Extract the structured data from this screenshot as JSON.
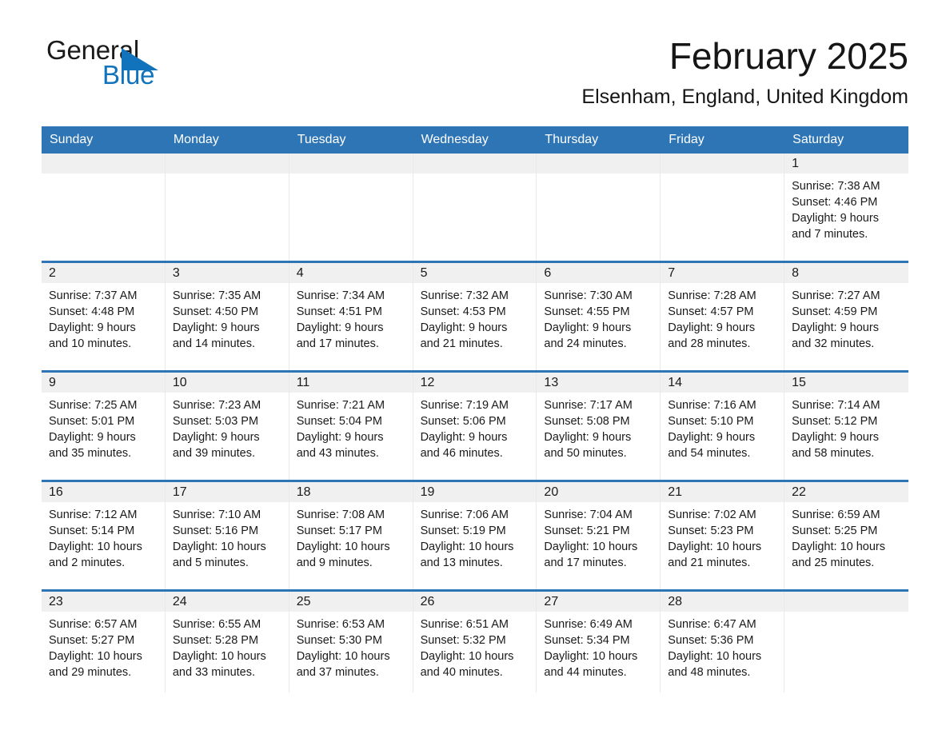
{
  "brand": {
    "name_part1": "General",
    "name_part2": "Blue",
    "triangle_color": "#1173bb",
    "text_color": "#1a1a1a"
  },
  "header": {
    "title": "February 2025",
    "subtitle": "Elsenham, England, United Kingdom"
  },
  "theme": {
    "header_blue": "#2e75b6",
    "day_band_gray": "#f0f0f0",
    "cell_border": "#e9e9e9"
  },
  "weekdays": [
    "Sunday",
    "Monday",
    "Tuesday",
    "Wednesday",
    "Thursday",
    "Friday",
    "Saturday"
  ],
  "weeks": [
    [
      {
        "day": "",
        "sunrise": "",
        "sunset": "",
        "daylight_line1": "",
        "daylight_line2": "",
        "empty": true
      },
      {
        "day": "",
        "sunrise": "",
        "sunset": "",
        "daylight_line1": "",
        "daylight_line2": "",
        "empty": true
      },
      {
        "day": "",
        "sunrise": "",
        "sunset": "",
        "daylight_line1": "",
        "daylight_line2": "",
        "empty": true
      },
      {
        "day": "",
        "sunrise": "",
        "sunset": "",
        "daylight_line1": "",
        "daylight_line2": "",
        "empty": true
      },
      {
        "day": "",
        "sunrise": "",
        "sunset": "",
        "daylight_line1": "",
        "daylight_line2": "",
        "empty": true
      },
      {
        "day": "",
        "sunrise": "",
        "sunset": "",
        "daylight_line1": "",
        "daylight_line2": "",
        "empty": true
      },
      {
        "day": "1",
        "sunrise": "Sunrise: 7:38 AM",
        "sunset": "Sunset: 4:46 PM",
        "daylight_line1": "Daylight: 9 hours",
        "daylight_line2": "and 7 minutes.",
        "empty": false
      }
    ],
    [
      {
        "day": "2",
        "sunrise": "Sunrise: 7:37 AM",
        "sunset": "Sunset: 4:48 PM",
        "daylight_line1": "Daylight: 9 hours",
        "daylight_line2": "and 10 minutes.",
        "empty": false
      },
      {
        "day": "3",
        "sunrise": "Sunrise: 7:35 AM",
        "sunset": "Sunset: 4:50 PM",
        "daylight_line1": "Daylight: 9 hours",
        "daylight_line2": "and 14 minutes.",
        "empty": false
      },
      {
        "day": "4",
        "sunrise": "Sunrise: 7:34 AM",
        "sunset": "Sunset: 4:51 PM",
        "daylight_line1": "Daylight: 9 hours",
        "daylight_line2": "and 17 minutes.",
        "empty": false
      },
      {
        "day": "5",
        "sunrise": "Sunrise: 7:32 AM",
        "sunset": "Sunset: 4:53 PM",
        "daylight_line1": "Daylight: 9 hours",
        "daylight_line2": "and 21 minutes.",
        "empty": false
      },
      {
        "day": "6",
        "sunrise": "Sunrise: 7:30 AM",
        "sunset": "Sunset: 4:55 PM",
        "daylight_line1": "Daylight: 9 hours",
        "daylight_line2": "and 24 minutes.",
        "empty": false
      },
      {
        "day": "7",
        "sunrise": "Sunrise: 7:28 AM",
        "sunset": "Sunset: 4:57 PM",
        "daylight_line1": "Daylight: 9 hours",
        "daylight_line2": "and 28 minutes.",
        "empty": false
      },
      {
        "day": "8",
        "sunrise": "Sunrise: 7:27 AM",
        "sunset": "Sunset: 4:59 PM",
        "daylight_line1": "Daylight: 9 hours",
        "daylight_line2": "and 32 minutes.",
        "empty": false
      }
    ],
    [
      {
        "day": "9",
        "sunrise": "Sunrise: 7:25 AM",
        "sunset": "Sunset: 5:01 PM",
        "daylight_line1": "Daylight: 9 hours",
        "daylight_line2": "and 35 minutes.",
        "empty": false
      },
      {
        "day": "10",
        "sunrise": "Sunrise: 7:23 AM",
        "sunset": "Sunset: 5:03 PM",
        "daylight_line1": "Daylight: 9 hours",
        "daylight_line2": "and 39 minutes.",
        "empty": false
      },
      {
        "day": "11",
        "sunrise": "Sunrise: 7:21 AM",
        "sunset": "Sunset: 5:04 PM",
        "daylight_line1": "Daylight: 9 hours",
        "daylight_line2": "and 43 minutes.",
        "empty": false
      },
      {
        "day": "12",
        "sunrise": "Sunrise: 7:19 AM",
        "sunset": "Sunset: 5:06 PM",
        "daylight_line1": "Daylight: 9 hours",
        "daylight_line2": "and 46 minutes.",
        "empty": false
      },
      {
        "day": "13",
        "sunrise": "Sunrise: 7:17 AM",
        "sunset": "Sunset: 5:08 PM",
        "daylight_line1": "Daylight: 9 hours",
        "daylight_line2": "and 50 minutes.",
        "empty": false
      },
      {
        "day": "14",
        "sunrise": "Sunrise: 7:16 AM",
        "sunset": "Sunset: 5:10 PM",
        "daylight_line1": "Daylight: 9 hours",
        "daylight_line2": "and 54 minutes.",
        "empty": false
      },
      {
        "day": "15",
        "sunrise": "Sunrise: 7:14 AM",
        "sunset": "Sunset: 5:12 PM",
        "daylight_line1": "Daylight: 9 hours",
        "daylight_line2": "and 58 minutes.",
        "empty": false
      }
    ],
    [
      {
        "day": "16",
        "sunrise": "Sunrise: 7:12 AM",
        "sunset": "Sunset: 5:14 PM",
        "daylight_line1": "Daylight: 10 hours",
        "daylight_line2": "and 2 minutes.",
        "empty": false
      },
      {
        "day": "17",
        "sunrise": "Sunrise: 7:10 AM",
        "sunset": "Sunset: 5:16 PM",
        "daylight_line1": "Daylight: 10 hours",
        "daylight_line2": "and 5 minutes.",
        "empty": false
      },
      {
        "day": "18",
        "sunrise": "Sunrise: 7:08 AM",
        "sunset": "Sunset: 5:17 PM",
        "daylight_line1": "Daylight: 10 hours",
        "daylight_line2": "and 9 minutes.",
        "empty": false
      },
      {
        "day": "19",
        "sunrise": "Sunrise: 7:06 AM",
        "sunset": "Sunset: 5:19 PM",
        "daylight_line1": "Daylight: 10 hours",
        "daylight_line2": "and 13 minutes.",
        "empty": false
      },
      {
        "day": "20",
        "sunrise": "Sunrise: 7:04 AM",
        "sunset": "Sunset: 5:21 PM",
        "daylight_line1": "Daylight: 10 hours",
        "daylight_line2": "and 17 minutes.",
        "empty": false
      },
      {
        "day": "21",
        "sunrise": "Sunrise: 7:02 AM",
        "sunset": "Sunset: 5:23 PM",
        "daylight_line1": "Daylight: 10 hours",
        "daylight_line2": "and 21 minutes.",
        "empty": false
      },
      {
        "day": "22",
        "sunrise": "Sunrise: 6:59 AM",
        "sunset": "Sunset: 5:25 PM",
        "daylight_line1": "Daylight: 10 hours",
        "daylight_line2": "and 25 minutes.",
        "empty": false
      }
    ],
    [
      {
        "day": "23",
        "sunrise": "Sunrise: 6:57 AM",
        "sunset": "Sunset: 5:27 PM",
        "daylight_line1": "Daylight: 10 hours",
        "daylight_line2": "and 29 minutes.",
        "empty": false
      },
      {
        "day": "24",
        "sunrise": "Sunrise: 6:55 AM",
        "sunset": "Sunset: 5:28 PM",
        "daylight_line1": "Daylight: 10 hours",
        "daylight_line2": "and 33 minutes.",
        "empty": false
      },
      {
        "day": "25",
        "sunrise": "Sunrise: 6:53 AM",
        "sunset": "Sunset: 5:30 PM",
        "daylight_line1": "Daylight: 10 hours",
        "daylight_line2": "and 37 minutes.",
        "empty": false
      },
      {
        "day": "26",
        "sunrise": "Sunrise: 6:51 AM",
        "sunset": "Sunset: 5:32 PM",
        "daylight_line1": "Daylight: 10 hours",
        "daylight_line2": "and 40 minutes.",
        "empty": false
      },
      {
        "day": "27",
        "sunrise": "Sunrise: 6:49 AM",
        "sunset": "Sunset: 5:34 PM",
        "daylight_line1": "Daylight: 10 hours",
        "daylight_line2": "and 44 minutes.",
        "empty": false
      },
      {
        "day": "28",
        "sunrise": "Sunrise: 6:47 AM",
        "sunset": "Sunset: 5:36 PM",
        "daylight_line1": "Daylight: 10 hours",
        "daylight_line2": "and 48 minutes.",
        "empty": false
      },
      {
        "day": "",
        "sunrise": "",
        "sunset": "",
        "daylight_line1": "",
        "daylight_line2": "",
        "empty": true
      }
    ]
  ]
}
